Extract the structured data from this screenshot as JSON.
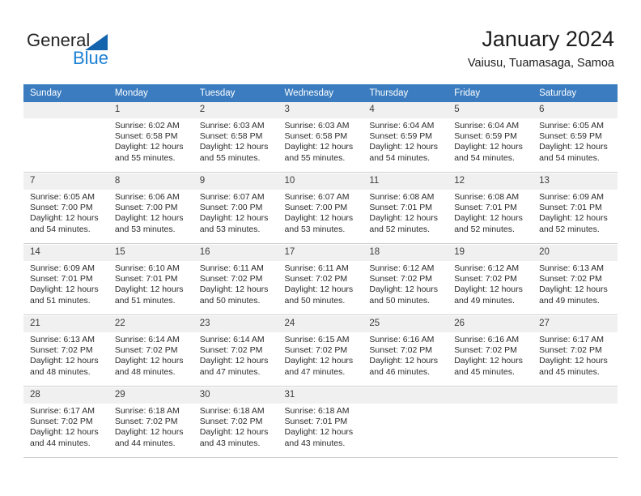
{
  "brand": {
    "name_part1": "General",
    "name_part2": "Blue",
    "triangle_color": "#1463ad",
    "blue_color": "#1b7fd4"
  },
  "header": {
    "title": "January 2024",
    "subtitle": "Vaiusu, Tuamasaga, Samoa"
  },
  "colors": {
    "header_row_bg": "#3a7cbf",
    "header_row_text": "#ffffff",
    "daynum_shaded_bg": "#f0f0f0",
    "grid_line": "#cfcfcf",
    "body_text": "#2b2b2b"
  },
  "weekday_headers": [
    "Sunday",
    "Monday",
    "Tuesday",
    "Wednesday",
    "Thursday",
    "Friday",
    "Saturday"
  ],
  "weeks": [
    [
      {
        "day": "",
        "sunrise": "",
        "sunset": "",
        "daylight1": "",
        "daylight2": ""
      },
      {
        "day": "1",
        "sunrise": "Sunrise: 6:02 AM",
        "sunset": "Sunset: 6:58 PM",
        "daylight1": "Daylight: 12 hours",
        "daylight2": "and 55 minutes."
      },
      {
        "day": "2",
        "sunrise": "Sunrise: 6:03 AM",
        "sunset": "Sunset: 6:58 PM",
        "daylight1": "Daylight: 12 hours",
        "daylight2": "and 55 minutes."
      },
      {
        "day": "3",
        "sunrise": "Sunrise: 6:03 AM",
        "sunset": "Sunset: 6:58 PM",
        "daylight1": "Daylight: 12 hours",
        "daylight2": "and 55 minutes."
      },
      {
        "day": "4",
        "sunrise": "Sunrise: 6:04 AM",
        "sunset": "Sunset: 6:59 PM",
        "daylight1": "Daylight: 12 hours",
        "daylight2": "and 54 minutes."
      },
      {
        "day": "5",
        "sunrise": "Sunrise: 6:04 AM",
        "sunset": "Sunset: 6:59 PM",
        "daylight1": "Daylight: 12 hours",
        "daylight2": "and 54 minutes."
      },
      {
        "day": "6",
        "sunrise": "Sunrise: 6:05 AM",
        "sunset": "Sunset: 6:59 PM",
        "daylight1": "Daylight: 12 hours",
        "daylight2": "and 54 minutes."
      }
    ],
    [
      {
        "day": "7",
        "sunrise": "Sunrise: 6:05 AM",
        "sunset": "Sunset: 7:00 PM",
        "daylight1": "Daylight: 12 hours",
        "daylight2": "and 54 minutes."
      },
      {
        "day": "8",
        "sunrise": "Sunrise: 6:06 AM",
        "sunset": "Sunset: 7:00 PM",
        "daylight1": "Daylight: 12 hours",
        "daylight2": "and 53 minutes."
      },
      {
        "day": "9",
        "sunrise": "Sunrise: 6:07 AM",
        "sunset": "Sunset: 7:00 PM",
        "daylight1": "Daylight: 12 hours",
        "daylight2": "and 53 minutes."
      },
      {
        "day": "10",
        "sunrise": "Sunrise: 6:07 AM",
        "sunset": "Sunset: 7:00 PM",
        "daylight1": "Daylight: 12 hours",
        "daylight2": "and 53 minutes."
      },
      {
        "day": "11",
        "sunrise": "Sunrise: 6:08 AM",
        "sunset": "Sunset: 7:01 PM",
        "daylight1": "Daylight: 12 hours",
        "daylight2": "and 52 minutes."
      },
      {
        "day": "12",
        "sunrise": "Sunrise: 6:08 AM",
        "sunset": "Sunset: 7:01 PM",
        "daylight1": "Daylight: 12 hours",
        "daylight2": "and 52 minutes."
      },
      {
        "day": "13",
        "sunrise": "Sunrise: 6:09 AM",
        "sunset": "Sunset: 7:01 PM",
        "daylight1": "Daylight: 12 hours",
        "daylight2": "and 52 minutes."
      }
    ],
    [
      {
        "day": "14",
        "sunrise": "Sunrise: 6:09 AM",
        "sunset": "Sunset: 7:01 PM",
        "daylight1": "Daylight: 12 hours",
        "daylight2": "and 51 minutes."
      },
      {
        "day": "15",
        "sunrise": "Sunrise: 6:10 AM",
        "sunset": "Sunset: 7:01 PM",
        "daylight1": "Daylight: 12 hours",
        "daylight2": "and 51 minutes."
      },
      {
        "day": "16",
        "sunrise": "Sunrise: 6:11 AM",
        "sunset": "Sunset: 7:02 PM",
        "daylight1": "Daylight: 12 hours",
        "daylight2": "and 50 minutes."
      },
      {
        "day": "17",
        "sunrise": "Sunrise: 6:11 AM",
        "sunset": "Sunset: 7:02 PM",
        "daylight1": "Daylight: 12 hours",
        "daylight2": "and 50 minutes."
      },
      {
        "day": "18",
        "sunrise": "Sunrise: 6:12 AM",
        "sunset": "Sunset: 7:02 PM",
        "daylight1": "Daylight: 12 hours",
        "daylight2": "and 50 minutes."
      },
      {
        "day": "19",
        "sunrise": "Sunrise: 6:12 AM",
        "sunset": "Sunset: 7:02 PM",
        "daylight1": "Daylight: 12 hours",
        "daylight2": "and 49 minutes."
      },
      {
        "day": "20",
        "sunrise": "Sunrise: 6:13 AM",
        "sunset": "Sunset: 7:02 PM",
        "daylight1": "Daylight: 12 hours",
        "daylight2": "and 49 minutes."
      }
    ],
    [
      {
        "day": "21",
        "sunrise": "Sunrise: 6:13 AM",
        "sunset": "Sunset: 7:02 PM",
        "daylight1": "Daylight: 12 hours",
        "daylight2": "and 48 minutes."
      },
      {
        "day": "22",
        "sunrise": "Sunrise: 6:14 AM",
        "sunset": "Sunset: 7:02 PM",
        "daylight1": "Daylight: 12 hours",
        "daylight2": "and 48 minutes."
      },
      {
        "day": "23",
        "sunrise": "Sunrise: 6:14 AM",
        "sunset": "Sunset: 7:02 PM",
        "daylight1": "Daylight: 12 hours",
        "daylight2": "and 47 minutes."
      },
      {
        "day": "24",
        "sunrise": "Sunrise: 6:15 AM",
        "sunset": "Sunset: 7:02 PM",
        "daylight1": "Daylight: 12 hours",
        "daylight2": "and 47 minutes."
      },
      {
        "day": "25",
        "sunrise": "Sunrise: 6:16 AM",
        "sunset": "Sunset: 7:02 PM",
        "daylight1": "Daylight: 12 hours",
        "daylight2": "and 46 minutes."
      },
      {
        "day": "26",
        "sunrise": "Sunrise: 6:16 AM",
        "sunset": "Sunset: 7:02 PM",
        "daylight1": "Daylight: 12 hours",
        "daylight2": "and 45 minutes."
      },
      {
        "day": "27",
        "sunrise": "Sunrise: 6:17 AM",
        "sunset": "Sunset: 7:02 PM",
        "daylight1": "Daylight: 12 hours",
        "daylight2": "and 45 minutes."
      }
    ],
    [
      {
        "day": "28",
        "sunrise": "Sunrise: 6:17 AM",
        "sunset": "Sunset: 7:02 PM",
        "daylight1": "Daylight: 12 hours",
        "daylight2": "and 44 minutes."
      },
      {
        "day": "29",
        "sunrise": "Sunrise: 6:18 AM",
        "sunset": "Sunset: 7:02 PM",
        "daylight1": "Daylight: 12 hours",
        "daylight2": "and 44 minutes."
      },
      {
        "day": "30",
        "sunrise": "Sunrise: 6:18 AM",
        "sunset": "Sunset: 7:02 PM",
        "daylight1": "Daylight: 12 hours",
        "daylight2": "and 43 minutes."
      },
      {
        "day": "31",
        "sunrise": "Sunrise: 6:18 AM",
        "sunset": "Sunset: 7:01 PM",
        "daylight1": "Daylight: 12 hours",
        "daylight2": "and 43 minutes."
      },
      {
        "day": "",
        "sunrise": "",
        "sunset": "",
        "daylight1": "",
        "daylight2": ""
      },
      {
        "day": "",
        "sunrise": "",
        "sunset": "",
        "daylight1": "",
        "daylight2": ""
      },
      {
        "day": "",
        "sunrise": "",
        "sunset": "",
        "daylight1": "",
        "daylight2": ""
      }
    ]
  ]
}
